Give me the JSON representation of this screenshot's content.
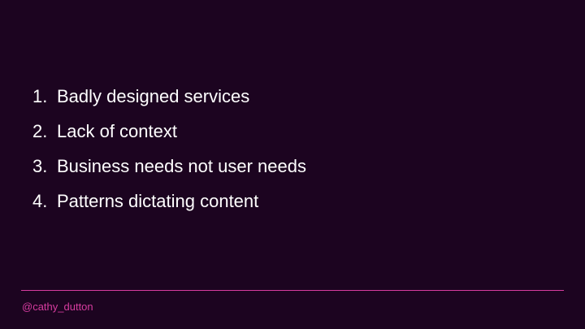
{
  "slide": {
    "items": [
      {
        "number": "1.",
        "text": "Badly designed services"
      },
      {
        "number": "2.",
        "text": "Lack of context"
      },
      {
        "number": "3.",
        "text": "Business needs not user needs"
      },
      {
        "number": "4.",
        "text": "Patterns dictating content"
      }
    ],
    "footer": {
      "handle": "@cathy_dutton"
    }
  },
  "colors": {
    "background": "#1c0420",
    "text": "#ffffff",
    "accent": "#d63c9f"
  }
}
